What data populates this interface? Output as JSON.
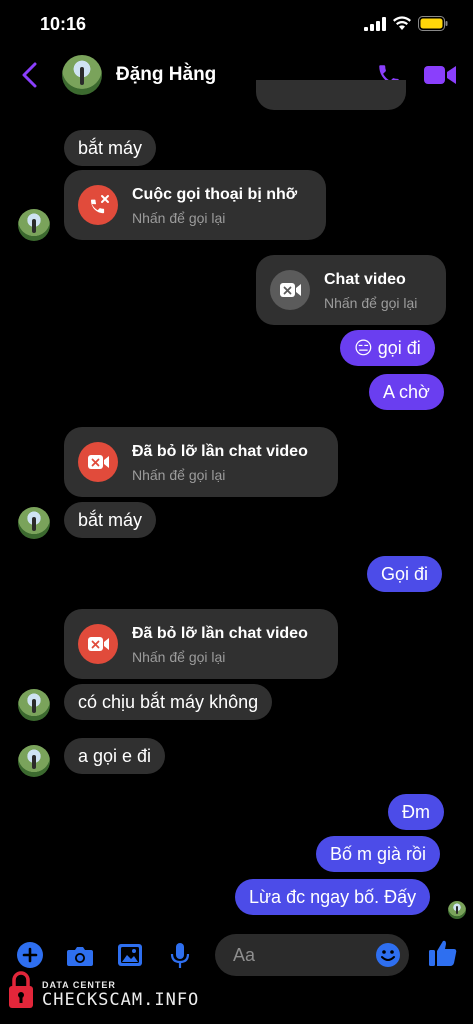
{
  "status": {
    "time": "10:16"
  },
  "header": {
    "name": "Đặng Hằng"
  },
  "messages": {
    "m1": "bắt máy",
    "call1_title": "Cuộc gọi thoại bị nhỡ",
    "call1_sub": "Nhấn để gọi lại",
    "call2_title": "Chat video",
    "call2_sub": "Nhấn để gọi lại",
    "m2": "😑 gọi đi",
    "m3": "A chờ",
    "call3_title": "Đã bỏ lỡ lần chat video",
    "call3_sub": "Nhấn để gọi lại",
    "m4": "bắt máy",
    "m5": "Gọi đi",
    "call4_title": "Đã bỏ lỡ lần chat video",
    "call4_sub": "Nhấn để gọi lại",
    "m6": "có chịu bắt máy không",
    "m7": "a gọi e đi",
    "m8": "Đm",
    "m9": "Bố m già rồi",
    "m10": "Lừa đc ngay bố.  Đấy"
  },
  "composer": {
    "placeholder": "Aa"
  },
  "watermark": {
    "top": "DATA CENTER",
    "main": "CHECKSCAM.INFO"
  },
  "colors": {
    "accent": "#8a3ffc",
    "sent": "#4c4ce8",
    "received": "#303030",
    "missed": "#e14b3b"
  }
}
